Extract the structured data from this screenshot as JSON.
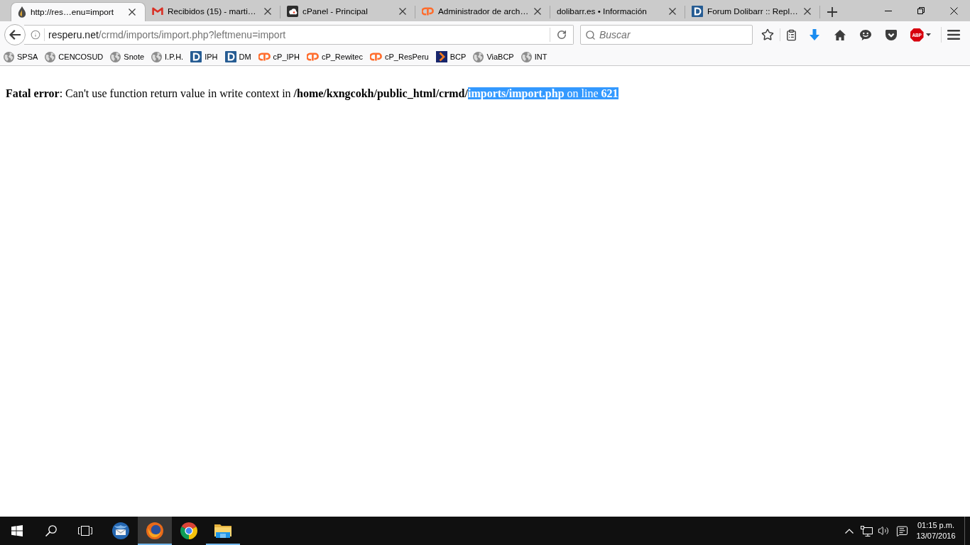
{
  "browser": {
    "tabs": [
      {
        "title": "http://res…enu=import",
        "kind": "drop",
        "selected": true
      },
      {
        "title": "Recibidos (15) - marti…",
        "kind": "mail",
        "selected": false
      },
      {
        "title": "cPanel - Principal",
        "kind": "cloud",
        "selected": false
      },
      {
        "title": "Administrador de arch…",
        "kind": "cpanel",
        "selected": false
      },
      {
        "title": "dolibarr.es • Información",
        "kind": "none",
        "selected": false
      },
      {
        "title": "Forum Dolibarr :: Repl…",
        "kind": "dolibarr",
        "selected": false
      }
    ],
    "address_bar": {
      "host": "resperu.net",
      "path": "/crmd/imports/import.php?leftmenu=import"
    },
    "search": {
      "placeholder": "Buscar"
    },
    "adblock_badge": "ABP",
    "bookmarks": [
      {
        "label": "SPSA",
        "kind": "globe"
      },
      {
        "label": "CENCOSUD",
        "kind": "globe"
      },
      {
        "label": "Snote",
        "kind": "globe"
      },
      {
        "label": "I.P.H.",
        "kind": "globe"
      },
      {
        "label": "IPH",
        "kind": "dolibarr"
      },
      {
        "label": "DM",
        "kind": "dolibarr"
      },
      {
        "label": "cP_IPH",
        "kind": "cpanel"
      },
      {
        "label": "cP_Rewitec",
        "kind": "cpanel"
      },
      {
        "label": "cP_ResPeru",
        "kind": "cpanel"
      },
      {
        "label": "BCP",
        "kind": "bcp"
      },
      {
        "label": "ViaBCP",
        "kind": "globe"
      },
      {
        "label": "INT",
        "kind": "globe"
      }
    ]
  },
  "page": {
    "error_segments": [
      {
        "text": "**Fatal error**: Can't use function return value in write context in **/home/kxngcokh/public_html/crmd/**",
        "selected": false
      },
      {
        "text": "**imports/import.php** on line **621**",
        "selected": true
      }
    ]
  },
  "taskbar": {
    "apps": [
      {
        "kind": "thunderbird",
        "selected": false,
        "running": false
      },
      {
        "kind": "firefox",
        "selected": true,
        "running": true
      },
      {
        "kind": "chrome",
        "selected": false,
        "running": false
      },
      {
        "kind": "explorer",
        "selected": false,
        "running": true
      }
    ],
    "clock": {
      "time": "01:15 p.m.",
      "date": "13/07/2016"
    }
  }
}
